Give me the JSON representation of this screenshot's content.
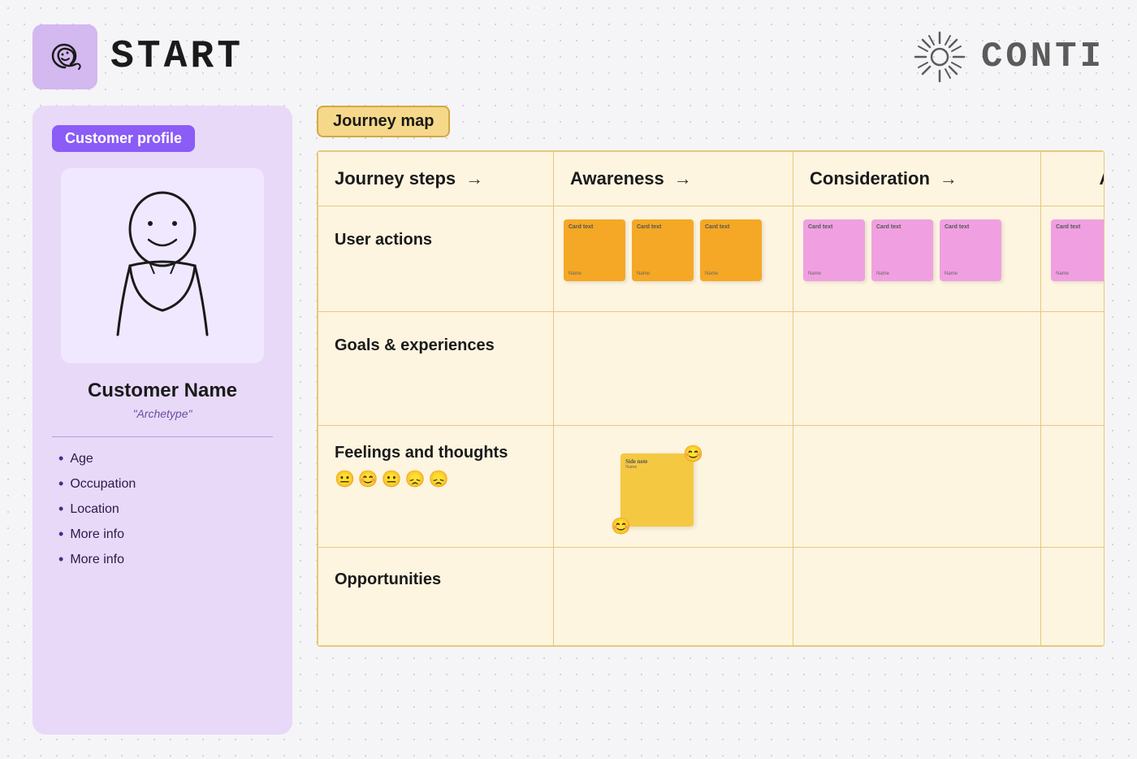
{
  "header": {
    "start_label": "START",
    "continue_label": "CONTI",
    "icon_alt": "start-icon",
    "sunburst_alt": "sunburst-icon"
  },
  "customer_profile": {
    "section_label": "Customer profile",
    "customer_name": "Customer Name",
    "archetype": "\"Archetype\"",
    "list_items": [
      "Age",
      "Occupation",
      "Location",
      "More info",
      "More info"
    ]
  },
  "journey_map": {
    "label": "Journey map",
    "columns": {
      "steps": "Journey steps",
      "awareness": "Awareness",
      "consideration": "Consideration",
      "next": "A"
    },
    "rows": {
      "user_actions": "User actions",
      "goals": "Goals & experiences",
      "feelings": "Feelings and thoughts",
      "opportunities": "Opportunities"
    },
    "emojis": [
      "😐",
      "😊",
      "😐",
      "😞",
      "😞"
    ],
    "awareness_notes": [
      {
        "title": "Card text",
        "footer": "Name"
      },
      {
        "title": "Card text",
        "footer": "Name"
      },
      {
        "title": "Card text",
        "footer": "Name"
      }
    ],
    "consideration_notes": [
      {
        "title": "Card text",
        "footer": "Name"
      },
      {
        "title": "Card text",
        "footer": "Name"
      },
      {
        "title": "Card text",
        "footer": "Name"
      }
    ],
    "feelings_note": {
      "title": "Side note",
      "footer": "Name"
    }
  },
  "colors": {
    "purple_bg": "#e8d9f8",
    "purple_accent": "#8b5cf6",
    "yellow_bg": "#fdf5e0",
    "orange_note": "#f5a825",
    "pink_note": "#f0a0e0",
    "gold_note": "#f5c842",
    "border_color": "#e8c97a"
  }
}
